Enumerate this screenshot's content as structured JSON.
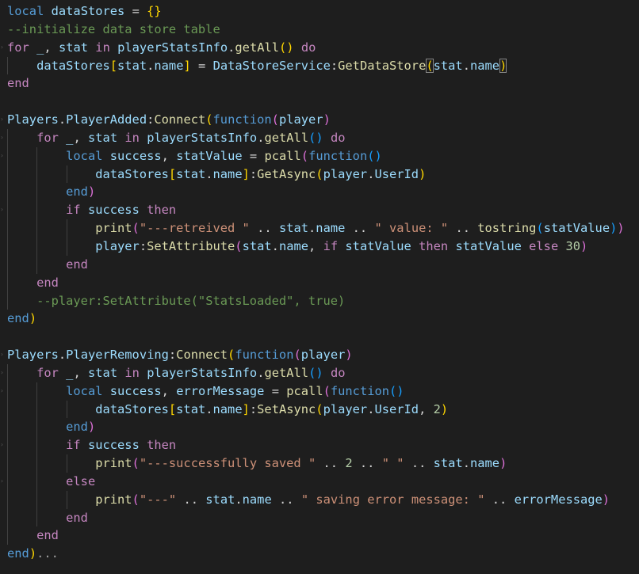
{
  "editor": {
    "theme": "dark",
    "background": "#1e1e1e",
    "collapsed_marker": "..."
  },
  "tokens": {
    "local": "local",
    "for": "for",
    "in": "in",
    "do": "do",
    "end": "end",
    "function": "function",
    "if": "if",
    "then": "then",
    "else": "else",
    "underscore": "_",
    "comma": ",",
    "eq": "=",
    "dot": ".",
    "colon": ":",
    "concat": "..",
    "lbrace": "{",
    "rbrace": "}",
    "lparen": "(",
    "rparen": ")",
    "lbracket": "[",
    "rbracket": "]",
    "dataStores": "dataStores",
    "stat": "stat",
    "name": "name",
    "playerStatsInfo": "playerStatsInfo",
    "getAll": "getAll",
    "DataStoreService": "DataStoreService",
    "GetDataStore": "GetDataStore",
    "Players": "Players",
    "PlayerAdded": "PlayerAdded",
    "PlayerRemoving": "PlayerRemoving",
    "Connect": "Connect",
    "player": "player",
    "success": "success",
    "statValue": "statValue",
    "errorMessage": "errorMessage",
    "pcall": "pcall",
    "GetAsync": "GetAsync",
    "SetAsync": "SetAsync",
    "UserId": "UserId",
    "print": "print",
    "tostring": "tostring",
    "SetAttribute": "SetAttribute",
    "num2": "2",
    "num30": "30"
  },
  "strings": {
    "retreived": "\"---retreived \"",
    "value": "\" value: \"",
    "saved": "\"---successfully saved \"",
    "space": "\" \"",
    "dashes": "\"---\"",
    "saving_error": "\" saving error message: \""
  },
  "comments": {
    "init": "--initialize data store table",
    "stats_loaded": "--player:SetAttribute(\"StatsLoaded\", true)"
  }
}
